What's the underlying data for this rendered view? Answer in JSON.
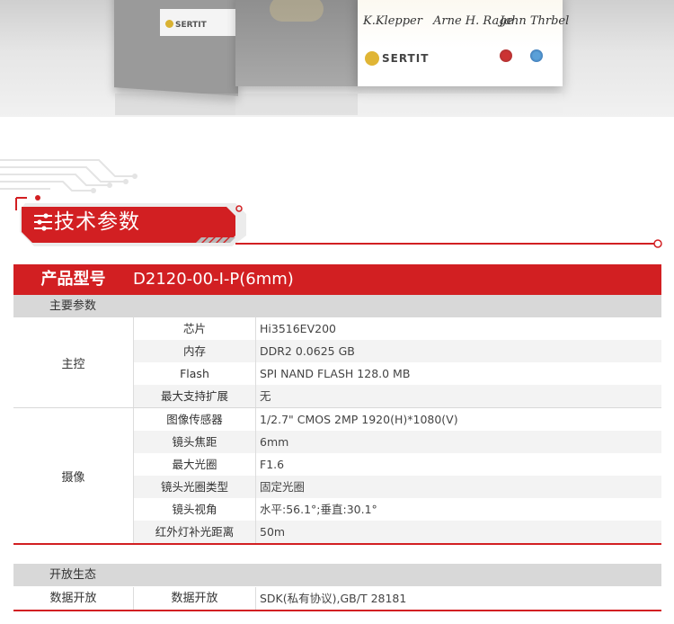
{
  "banner": {
    "left_logo": "SERTIT",
    "main_logo": "SERTIT",
    "signatures": [
      "K.Klepper",
      "Arne H. Rage",
      "Jahn Thrbel"
    ]
  },
  "colors": {
    "accent": "#d21f22",
    "group_bg": "#d8d8d8",
    "row_alt": "#f3f3f3"
  },
  "section": {
    "title": "技术参数",
    "icon": "sliders-icon"
  },
  "spec": {
    "model_label": "产品型号",
    "model_value": "D2120-00-I-P(6mm)",
    "groups": [
      {
        "title": "主要参数",
        "blocks": [
          {
            "label": "主控",
            "rows": [
              {
                "key": "芯片",
                "value": "Hi3516EV200"
              },
              {
                "key": "内存",
                "value": "DDR2 0.0625 GB"
              },
              {
                "key": "Flash",
                "value": "SPI NAND FLASH 128.0 MB"
              },
              {
                "key": "最大支持扩展",
                "value": "无"
              }
            ]
          },
          {
            "label": "摄像",
            "rows": [
              {
                "key": "图像传感器",
                "value": "1/2.7\" CMOS 2MP 1920(H)*1080(V)"
              },
              {
                "key": "镜头焦距",
                "value": "6mm"
              },
              {
                "key": "最大光圈",
                "value": "F1.6"
              },
              {
                "key": "镜头光圈类型",
                "value": "固定光圈"
              },
              {
                "key": "镜头视角",
                "value": "水平:56.1°;垂直:30.1°"
              },
              {
                "key": "红外灯补光距离",
                "value": "50m"
              }
            ]
          }
        ]
      },
      {
        "title": "开放生态",
        "blocks": [
          {
            "label": "数据开放",
            "rows": [
              {
                "key": "数据开放",
                "value": "SDK(私有协议),GB/T 28181"
              }
            ]
          }
        ]
      }
    ]
  }
}
